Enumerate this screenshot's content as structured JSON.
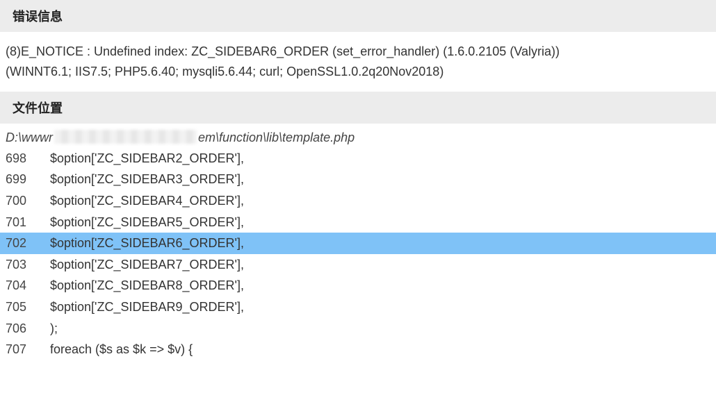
{
  "sections": {
    "error_title": "错误信息",
    "file_title": "文件位置"
  },
  "error": {
    "line1": "(8)E_NOTICE : Undefined index: ZC_SIDEBAR6_ORDER (set_error_handler) (1.6.0.2105 (Valyria))",
    "line2": "(WINNT6.1; IIS7.5; PHP5.6.40; mysqli5.6.44; curl; OpenSSL1.0.2q20Nov2018)"
  },
  "file": {
    "path_prefix": "D:\\wwwr",
    "path_suffix": "em\\function\\lib\\template.php"
  },
  "highlighted_line": 702,
  "code_lines": [
    {
      "n": "698",
      "t": "$option['ZC_SIDEBAR2_ORDER'],"
    },
    {
      "n": "699",
      "t": "$option['ZC_SIDEBAR3_ORDER'],"
    },
    {
      "n": "700",
      "t": "$option['ZC_SIDEBAR4_ORDER'],"
    },
    {
      "n": "701",
      "t": "$option['ZC_SIDEBAR5_ORDER'],"
    },
    {
      "n": "702",
      "t": "$option['ZC_SIDEBAR6_ORDER'],"
    },
    {
      "n": "703",
      "t": "$option['ZC_SIDEBAR7_ORDER'],"
    },
    {
      "n": "704",
      "t": "$option['ZC_SIDEBAR8_ORDER'],"
    },
    {
      "n": "705",
      "t": "$option['ZC_SIDEBAR9_ORDER'],"
    },
    {
      "n": "706",
      "t": ");"
    },
    {
      "n": "707",
      "t": "foreach ($s as $k => $v) {"
    }
  ]
}
